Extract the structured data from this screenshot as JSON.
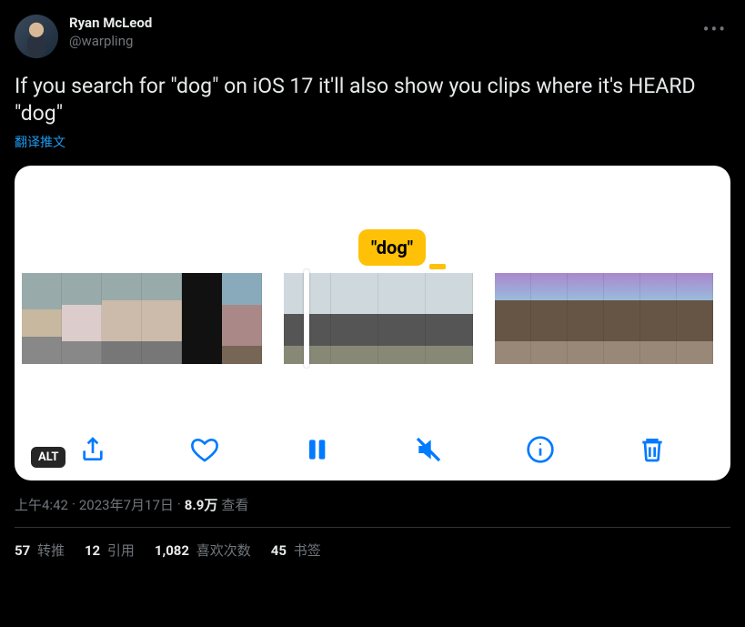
{
  "author": {
    "display_name": "Ryan McLeod",
    "handle": "@warpling"
  },
  "tweet_text": "If you search for \"dog\" on iOS 17 it'll also show you clips where it's HEARD \"dog\"",
  "translate_label": "翻译推文",
  "media": {
    "tooltip": "\"dog\"",
    "alt_badge": "ALT"
  },
  "meta": {
    "time": "上午4:42",
    "dot1": " · ",
    "date": "2023年7月17日",
    "dot2": " · ",
    "views_count": "8.9万",
    "views_label": " 查看"
  },
  "stats": {
    "retweets": {
      "count": "57",
      "label": " 转推"
    },
    "quotes": {
      "count": "12",
      "label": " 引用"
    },
    "likes": {
      "count": "1,082",
      "label": " 喜欢次数"
    },
    "bookmarks": {
      "count": "45",
      "label": " 书签"
    }
  }
}
